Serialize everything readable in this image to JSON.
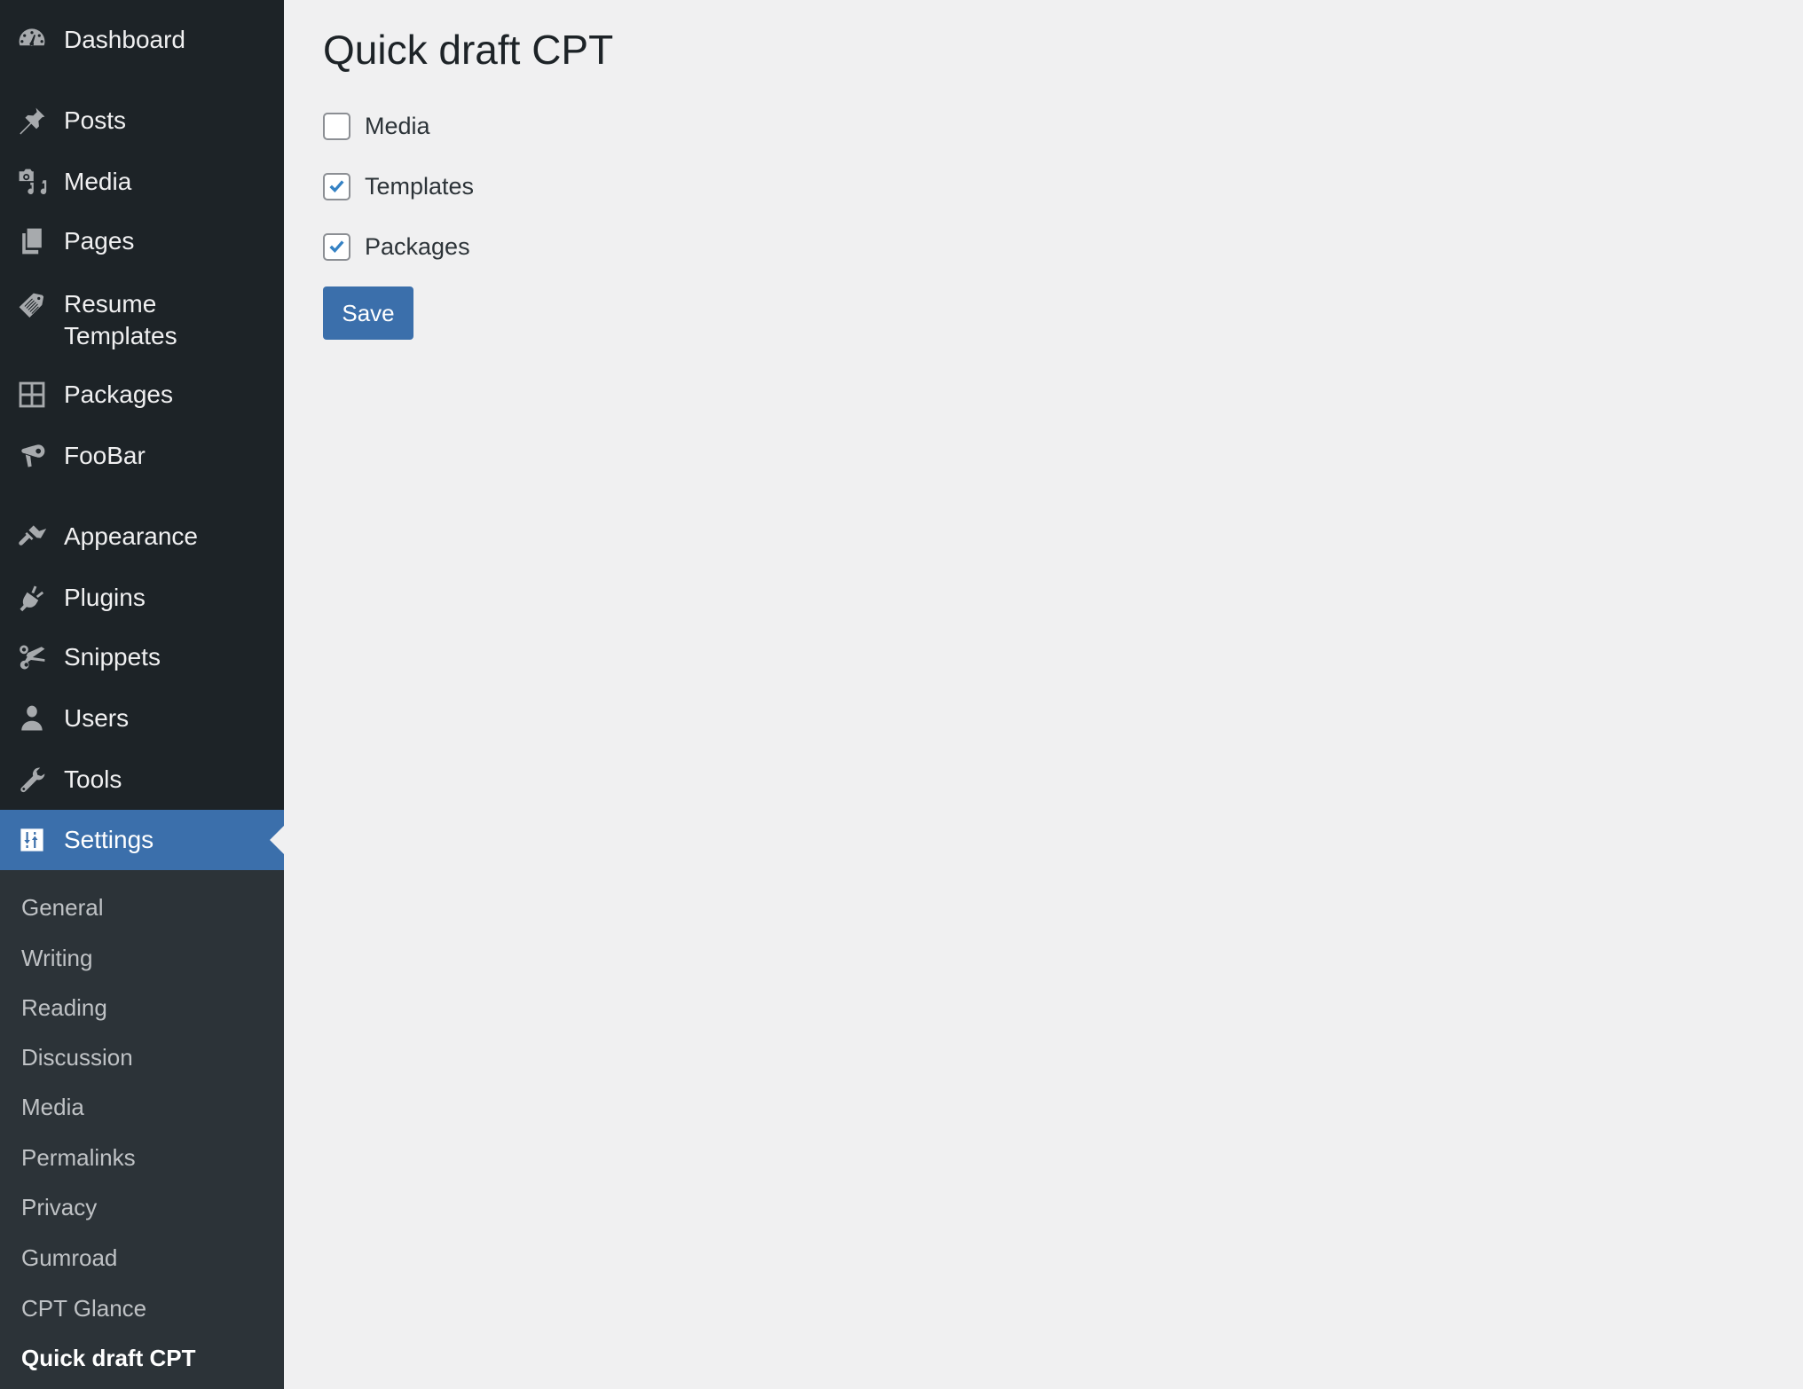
{
  "sidebar": {
    "items": [
      {
        "label": "Dashboard",
        "icon": "dashboard-icon"
      },
      {
        "label": "Posts",
        "icon": "pushpin-icon"
      },
      {
        "label": "Media",
        "icon": "media-icon"
      },
      {
        "label": "Pages",
        "icon": "pages-icon"
      },
      {
        "label": "Resume Templates",
        "label_line1": "Resume",
        "label_line2": "Templates",
        "icon": "tag-icon"
      },
      {
        "label": "Packages",
        "icon": "grid-icon"
      },
      {
        "label": "FooBar",
        "icon": "megaphone-icon"
      },
      {
        "label": "Appearance",
        "icon": "paintbrush-icon"
      },
      {
        "label": "Plugins",
        "icon": "plug-icon"
      },
      {
        "label": "Snippets",
        "icon": "scissors-icon"
      },
      {
        "label": "Users",
        "icon": "user-icon"
      },
      {
        "label": "Tools",
        "icon": "wrench-icon"
      },
      {
        "label": "Settings",
        "icon": "settings-sliders-icon",
        "active": true
      }
    ],
    "submenu": [
      {
        "label": "General"
      },
      {
        "label": "Writing"
      },
      {
        "label": "Reading"
      },
      {
        "label": "Discussion"
      },
      {
        "label": "Media"
      },
      {
        "label": "Permalinks"
      },
      {
        "label": "Privacy"
      },
      {
        "label": "Gumroad"
      },
      {
        "label": "CPT Glance"
      },
      {
        "label": "Quick draft CPT",
        "current": true
      }
    ]
  },
  "main": {
    "title": "Quick draft CPT",
    "options": [
      {
        "label": "Media",
        "checked": false
      },
      {
        "label": "Templates",
        "checked": true
      },
      {
        "label": "Packages",
        "checked": true
      }
    ],
    "save_label": "Save"
  },
  "colors": {
    "sidebar_bg": "#1d2327",
    "submenu_bg": "#2c3338",
    "accent": "#3b6fab",
    "page_bg": "#f0f0f1",
    "check": "#3582c4"
  }
}
